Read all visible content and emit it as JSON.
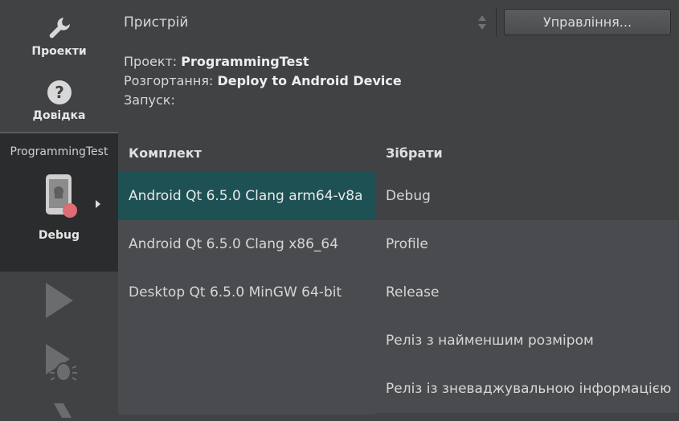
{
  "sidebar": {
    "modes": [
      {
        "label": "Проекти",
        "icon": "wrench-icon"
      },
      {
        "label": "Довідка",
        "icon": "help-icon"
      }
    ],
    "target": {
      "project": "ProgrammingTest",
      "build": "Debug",
      "icon": "android-device-icon"
    },
    "actions": [
      "run-icon",
      "debug-icon",
      "build-icon"
    ]
  },
  "header": {
    "device_label": "Пристрій",
    "manage_button": "Управління...",
    "project_label": "Проект:",
    "project_value": "ProgrammingTest",
    "deploy_label": "Розгортання:",
    "deploy_value": "Deploy to Android Device",
    "run_label": "Запуск:",
    "run_value": ""
  },
  "kits_column": {
    "header": "Комплект",
    "items": [
      "Android Qt 6.5.0 Clang arm64-v8a",
      "Android Qt 6.5.0 Clang x86_64",
      "Desktop Qt 6.5.0 MinGW 64-bit"
    ],
    "selected_index": 0
  },
  "builds_column": {
    "header": "Зібрати",
    "items": [
      "Debug",
      "Profile",
      "Release",
      "Реліз з найменшим розміром",
      "Реліз із зневаджувальною інформацією"
    ],
    "selected_index": 0
  },
  "colors": {
    "selection": "#1e5154",
    "status_dot": "#e06c75",
    "background": "#404244"
  }
}
